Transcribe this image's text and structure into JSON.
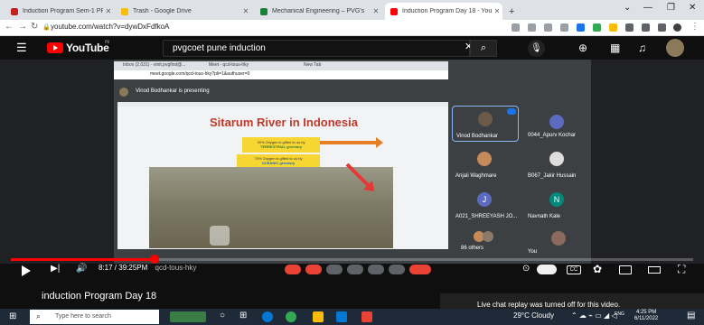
{
  "browser": {
    "tabs": [
      {
        "label": "Induction Program Sem-1 PPT - ",
        "color": "#c5221f"
      },
      {
        "label": "Trash - Google Drive",
        "color": "#1a73e8"
      },
      {
        "label": "Mechanical Engineering – PVG's",
        "color": "#188038"
      },
      {
        "label": "Induction Program Day 18 - You",
        "color": "#ff0000"
      }
    ],
    "new_tab_glyph": "+",
    "url": "youtube.com/watch?v=dywDxFdfkoA"
  },
  "youtube": {
    "logo_text": "YouTube",
    "region_code": "IN",
    "search_value": "pvgcoet pune induction"
  },
  "meet": {
    "inner_tabs": [
      "Inbox (2,031) - vinit.pvgfirst@...",
      "Meet - qcd-tous-hky",
      "New Tab"
    ],
    "inner_url": "meet.google.com/qcd-tous-hky?pli=1&authuser=0",
    "presenting_text": "Vinod Bodhankar is presenting",
    "slide_title": "Sitarum River in Indonesia",
    "callout1_line1": "30% Oxygen is gifted to us by",
    "callout1_line2": "TERRESTRIAL greenary",
    "callout2_line1": "70% Oxygen is gifted to us by",
    "callout2_line2": "OCEANIC greenary",
    "participants": [
      {
        "name": "Vinod Bodhankar"
      },
      {
        "name": "0044_Apurv Kochar"
      },
      {
        "name": "Anjali Waghmare"
      },
      {
        "name": "B067_Jakir Hussain"
      },
      {
        "name": "A021_SHREEYASH JO..."
      },
      {
        "name": "Navnath Kale"
      },
      {
        "name": "86 others"
      },
      {
        "name": "You"
      }
    ],
    "avatar_letters": [
      "J",
      "N"
    ],
    "meeting_code": "qcd-tous-hky"
  },
  "player": {
    "current_time": "8:17",
    "duration": "39:25",
    "suffix": "PM",
    "progress_fraction": 0.21,
    "cc_label": "CC"
  },
  "video_title": "induction Program Day 18",
  "chat_message": "Live chat replay was turned off for this video.",
  "taskbar": {
    "search_placeholder": "Type here to search",
    "weather": "29°C  Cloudy",
    "clock_time": "4:25 PM",
    "clock_date": "6/11/2022",
    "lang": "ENG"
  },
  "colors": {
    "yt_red": "#ff0000",
    "meet_red": "#ea4335",
    "progress_red": "#ff0000"
  }
}
